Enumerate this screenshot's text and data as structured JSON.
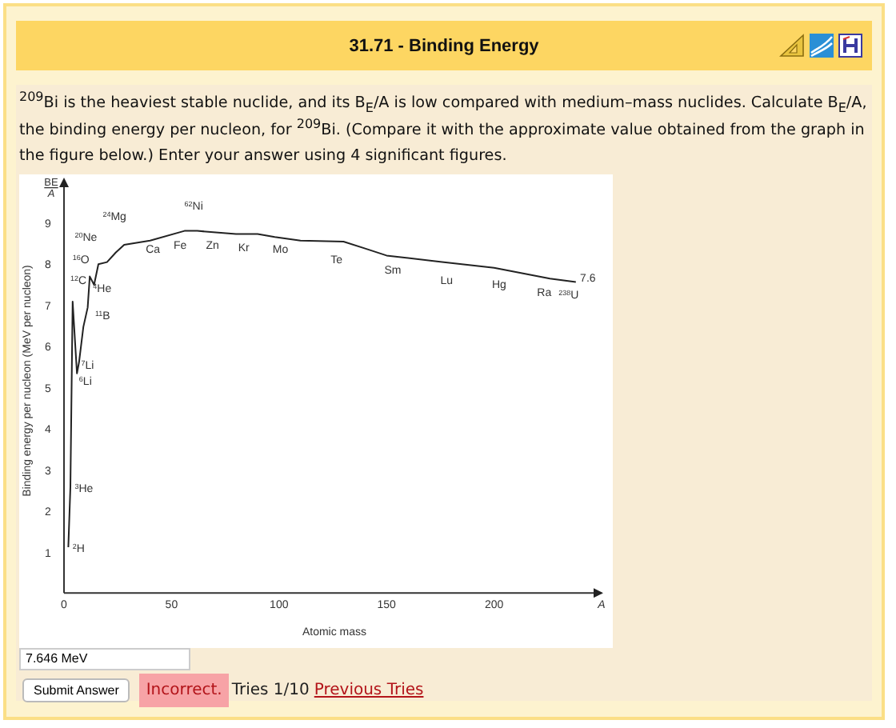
{
  "header": {
    "title": "31.71 - Binding Energy"
  },
  "question": "$^{209}$Bi is the heaviest stable nuclide, and its B$_{E}$/A is low compared with medium–mass nuclides. Calculate B$_{E}$/A, the binding energy per nucleon, for $^{209}$Bi. (Compare it with the approximate value obtained from the graph in the figure below.) Enter your answer using 4 significant figures.",
  "figure": {
    "chart_data": {
      "type": "line",
      "xlabel": "Atomic mass",
      "ylabel": "Binding energy per nucleon (MeV per nucleon)",
      "x": [
        2,
        3,
        4,
        6,
        7,
        9,
        11,
        12,
        14,
        16,
        20,
        24,
        28,
        40,
        56,
        62,
        80,
        90,
        98,
        110,
        130,
        140,
        150,
        175,
        200,
        226,
        238
      ],
      "series": [
        {
          "color": "#222222",
          "values": [
            1.11,
            2.57,
            7.07,
            5.33,
            5.6,
            6.46,
            6.93,
            7.68,
            7.48,
            7.98,
            8.03,
            8.26,
            8.45,
            8.55,
            8.79,
            8.79,
            8.71,
            8.71,
            8.64,
            8.55,
            8.53,
            8.36,
            8.19,
            8.04,
            7.89,
            7.63,
            7.55
          ]
        }
      ],
      "xlim": [
        0,
        250
      ],
      "ylim": [
        0,
        10
      ],
      "xticks": [
        0,
        50,
        100,
        150,
        200,
        {
          "value": 250,
          "label": "A"
        }
      ],
      "yticks": [
        1,
        2,
        3,
        4,
        5,
        6,
        7,
        8,
        9
      ]
    },
    "nuclide_labels": [
      {
        "mass": "62",
        "symbol": "Ni"
      },
      {
        "mass": "24",
        "symbol": "Mg"
      },
      {
        "mass": "20",
        "symbol": "Ne"
      },
      {
        "mass": "16",
        "symbol": "O"
      },
      {
        "mass": "12",
        "symbol": "C"
      },
      {
        "mass": "4",
        "symbol": "He"
      },
      {
        "mass": "11",
        "symbol": "B"
      },
      {
        "mass": "7",
        "symbol": "Li"
      },
      {
        "mass": "6",
        "symbol": "Li"
      },
      {
        "mass": "3",
        "symbol": "He"
      },
      {
        "mass": "2",
        "symbol": "H"
      },
      {
        "symbol": "Ca"
      },
      {
        "symbol": "Fe"
      },
      {
        "symbol": "Zn"
      },
      {
        "symbol": "Kr"
      },
      {
        "symbol": "Mo"
      },
      {
        "symbol": "Te"
      },
      {
        "symbol": "Sm"
      },
      {
        "symbol": "Lu"
      },
      {
        "symbol": "Hg"
      },
      {
        "symbol": "7.6"
      },
      {
        "symbol": "Ra"
      },
      {
        "mass": "238",
        "symbol": "U"
      }
    ],
    "axis_title": {
      "numerator": "BE",
      "denominator": "A"
    }
  },
  "answer": {
    "value": "7.646 MeV"
  },
  "submit": {
    "label": "Submit Answer"
  },
  "feedback": {
    "status": "Incorrect.",
    "tries": "Tries 1/10",
    "link": "Previous Tries"
  }
}
